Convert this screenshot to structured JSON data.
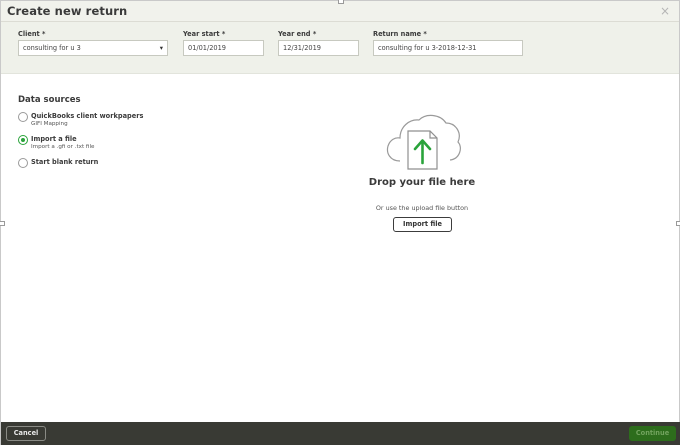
{
  "dialog": {
    "title": "Create new return",
    "close_glyph": "×"
  },
  "form": {
    "client": {
      "label": "Client *",
      "value": "consulting for u 3",
      "caret": "▾"
    },
    "year_start": {
      "label": "Year start *",
      "value": "01/01/2019"
    },
    "year_end": {
      "label": "Year end *",
      "value": "12/31/2019"
    },
    "return_name": {
      "label": "Return name *",
      "value": "consulting for u 3-2018-12-31"
    }
  },
  "data_sources": {
    "title": "Data sources",
    "options": [
      {
        "label": "QuickBooks client workpapers",
        "sub": "GIFI Mapping",
        "selected": false
      },
      {
        "label": "Import a file",
        "sub": "Import a .gfi or .txt file",
        "selected": true
      },
      {
        "label": "Start blank return",
        "sub": "",
        "selected": false
      }
    ]
  },
  "drop_zone": {
    "icon": "cloud-upload-icon",
    "title": "Drop your file here",
    "subtitle": "Or use the upload file button",
    "button_label": "Import file"
  },
  "footer": {
    "cancel_label": "Cancel",
    "continue_label": "Continue"
  },
  "colors": {
    "accent_green": "#2aa33b",
    "continue_bg": "#2d6d1c",
    "footer_bg": "#393a34",
    "form_band_bg": "#eff1ea"
  }
}
